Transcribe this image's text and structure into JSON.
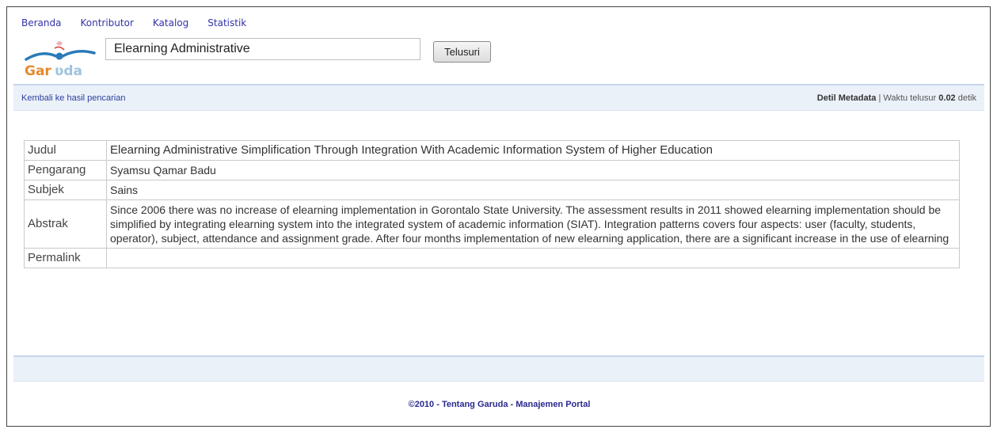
{
  "nav": {
    "items": [
      {
        "label": "Beranda"
      },
      {
        "label": "Kontributor"
      },
      {
        "label": "Katalog"
      },
      {
        "label": "Statistik"
      }
    ]
  },
  "logo": {
    "text": "Garuda",
    "colors": {
      "blue": "#2a7ab8",
      "orange": "#e68a2e",
      "red": "#d83b3b"
    }
  },
  "search": {
    "value": "Elearning Administrative",
    "button_label": "Telusuri"
  },
  "results_bar": {
    "back_label": "Kembali ke hasil pencarian",
    "detail_label": "Detil Metadata",
    "separator": "|",
    "time_prefix": "Waktu telusur",
    "time_value": "0.02",
    "time_suffix": "detik"
  },
  "metadata": {
    "rows": [
      {
        "label": "Judul",
        "value": "Elearning Administrative Simplification Through Integration With Academic Information System of Higher Education"
      },
      {
        "label": "Pengarang",
        "value": "Syamsu Qamar Badu"
      },
      {
        "label": "Subjek",
        "value": "Sains"
      },
      {
        "label": "Abstrak",
        "value": "Since 2006 there was no increase of elearning implementation in Gorontalo State University. The assessment results in 2011 showed elearning implementation should be simplified by integrating elearning system into the integrated system of academic information (SIAT). Integration patterns covers four aspects: user (faculty, students, operator), subject, attendance and assignment grade. After four months implementation of new elearning application, there are a significant increase in the use of elearning"
      },
      {
        "label": "Permalink",
        "value": ""
      }
    ]
  },
  "footer": {
    "copyright": "©2010 - Tentang Garuda - Manajemen Portal"
  }
}
